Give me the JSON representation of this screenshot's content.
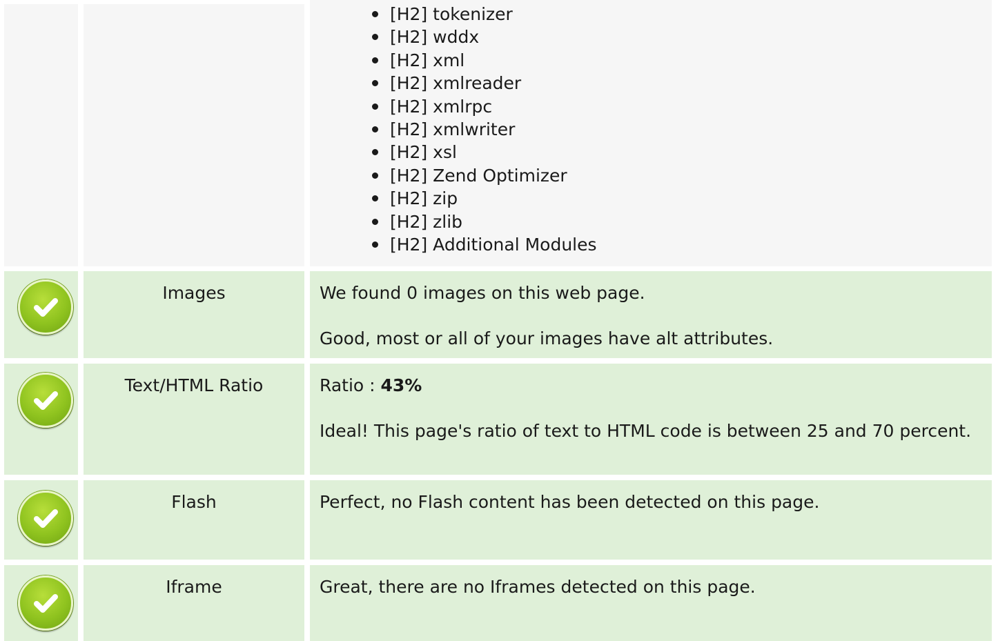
{
  "list": {
    "items": [
      "[H2] tokenizer",
      "[H2] wddx",
      "[H2] xml",
      "[H2] xmlreader",
      "[H2] xmlrpc",
      "[H2] xmlwriter",
      "[H2] xsl",
      "[H2] Zend Optimizer",
      "[H2] zip",
      "[H2] zlib",
      "[H2] Additional Modules"
    ]
  },
  "rows": {
    "images": {
      "label": "Images",
      "line1": "We found 0 images on this web page.",
      "line2": "Good, most or all of your images have alt attributes.",
      "status_icon": "check-circle-icon"
    },
    "ratio": {
      "label": "Text/HTML Ratio",
      "ratio_prefix": "Ratio : ",
      "ratio_value": "43%",
      "line2": "Ideal! This page's ratio of text to HTML code is between 25 and 70 percent.",
      "status_icon": "check-circle-icon"
    },
    "flash": {
      "label": "Flash",
      "line1": "Perfect, no Flash content has been detected on this page.",
      "status_icon": "check-circle-icon"
    },
    "iframe": {
      "label": "Iframe",
      "line1": "Great, there are no Iframes detected on this page.",
      "status_icon": "check-circle-icon"
    }
  },
  "colors": {
    "row_gray": "#f6f6f6",
    "row_green": "#dff0d8",
    "check_green": "#8fc31f"
  }
}
